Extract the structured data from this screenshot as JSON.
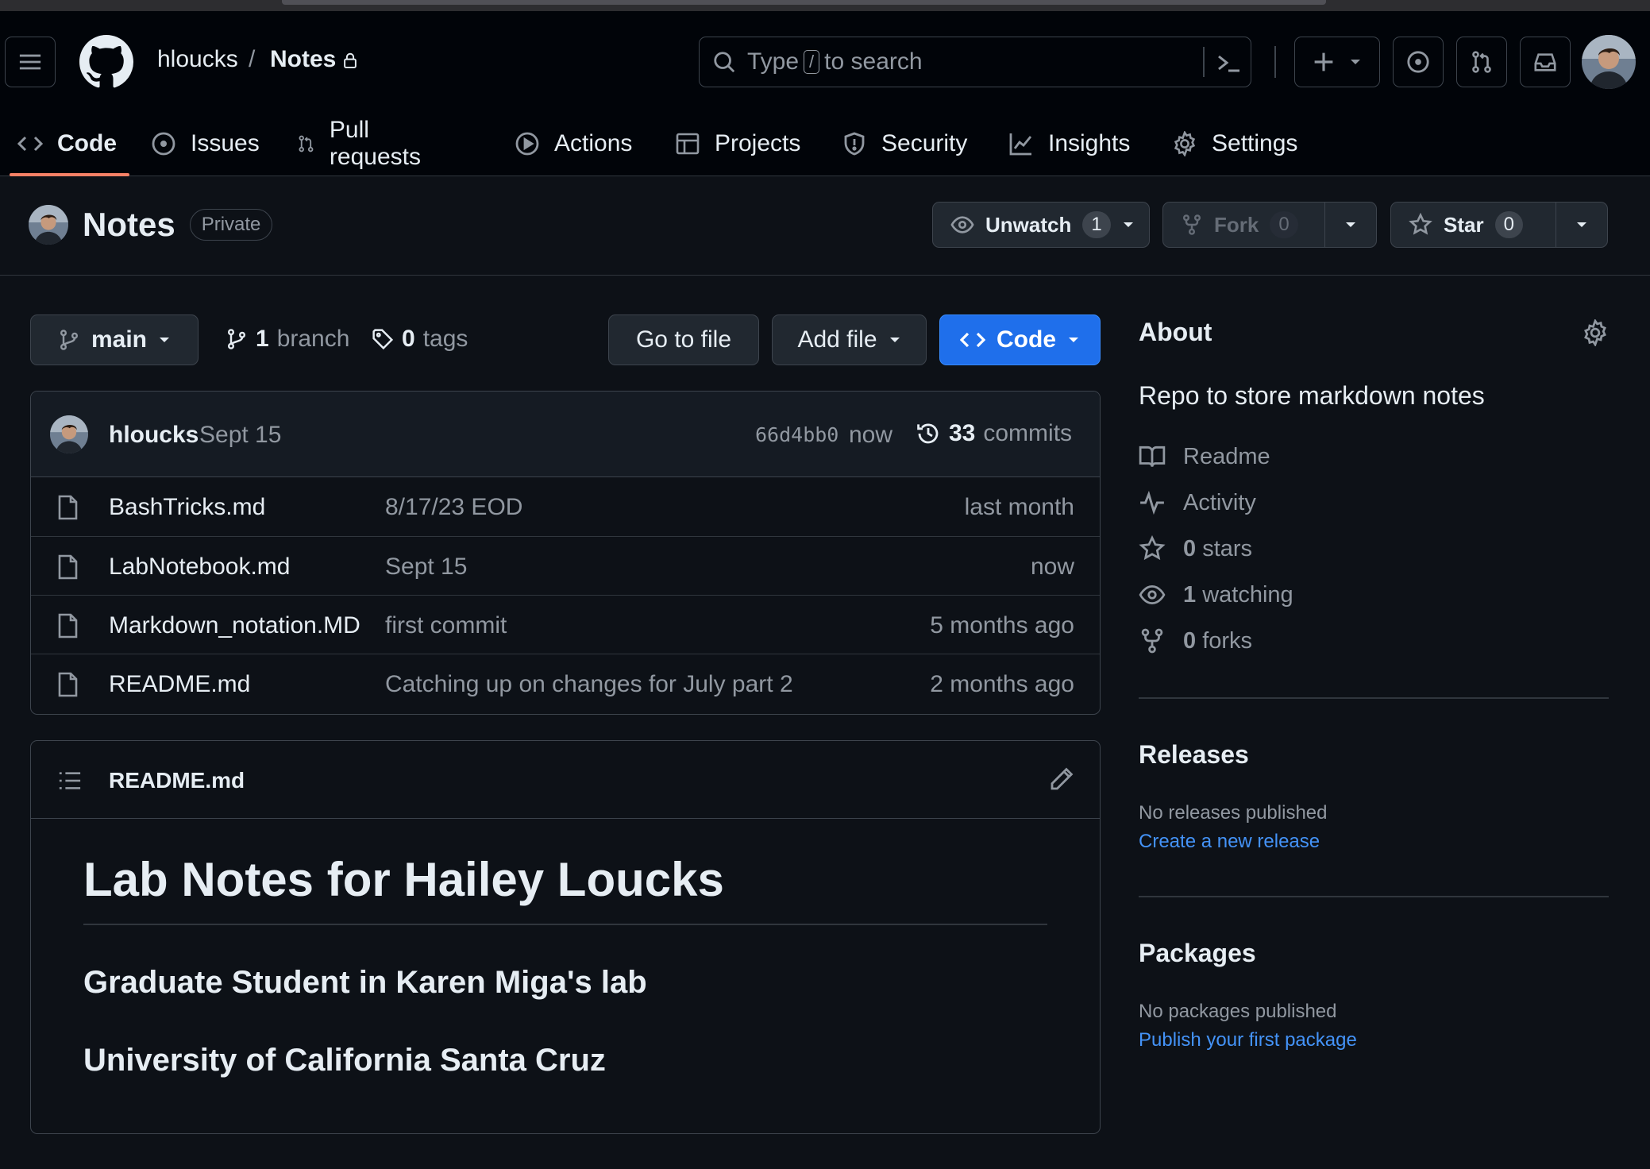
{
  "header": {
    "owner": "hloucks",
    "separator": "/",
    "repo": "Notes",
    "search": {
      "text_before": "Type",
      "key": "/",
      "text_after": "to search"
    },
    "icons": [
      "hamburger-icon",
      "github-logo-icon",
      "lock-icon",
      "search-icon",
      "command-palette-icon",
      "plus-icon",
      "issue-opened-icon",
      "pull-request-icon",
      "inbox-icon"
    ]
  },
  "nav": {
    "tabs": [
      {
        "label": "Code",
        "icon": "code-icon",
        "active": true
      },
      {
        "label": "Issues",
        "icon": "issue-icon"
      },
      {
        "label": "Pull requests",
        "icon": "pull-request-icon"
      },
      {
        "label": "Actions",
        "icon": "play-icon"
      },
      {
        "label": "Projects",
        "icon": "table-icon"
      },
      {
        "label": "Security",
        "icon": "shield-icon"
      },
      {
        "label": "Insights",
        "icon": "graph-icon"
      },
      {
        "label": "Settings",
        "icon": "gear-icon"
      }
    ]
  },
  "repo_header": {
    "name": "Notes",
    "visibility": "Private",
    "unwatch_label": "Unwatch",
    "watch_count": "1",
    "fork_label": "Fork",
    "fork_count": "0",
    "star_label": "Star",
    "star_count": "0"
  },
  "toolbar": {
    "branch": "main",
    "branch_count": "1",
    "branch_word": "branch",
    "tag_count": "0",
    "tag_word": "tags",
    "go_to_file": "Go to file",
    "add_file": "Add file",
    "code": "Code"
  },
  "latest_commit": {
    "author": "hloucks",
    "message": "Sept 15",
    "hash": "66d4bb0",
    "time": "now",
    "commit_count": "33",
    "commit_word": "commits"
  },
  "files": [
    {
      "name": "BashTricks.md",
      "message": "8/17/23 EOD",
      "time": "last month"
    },
    {
      "name": "LabNotebook.md",
      "message": "Sept 15",
      "time": "now"
    },
    {
      "name": "Markdown_notation.MD",
      "message": "first commit",
      "time": "5 months ago"
    },
    {
      "name": "README.md",
      "message": "Catching up on changes for July part 2",
      "time": "2 months ago"
    }
  ],
  "readme": {
    "filename": "README.md",
    "h1": "Lab Notes for Hailey Loucks",
    "h2_1": "Graduate Student in Karen Miga's lab",
    "h2_2": "University of California Santa Cruz"
  },
  "sidebar": {
    "about_title": "About",
    "description": "Repo to store markdown notes",
    "readme": "Readme",
    "activity": "Activity",
    "stars_count": "0",
    "stars_word": "stars",
    "watching_count": "1",
    "watching_word": "watching",
    "forks_count": "0",
    "forks_word": "forks",
    "releases_title": "Releases",
    "releases_empty": "No releases published",
    "releases_link": "Create a new release",
    "packages_title": "Packages",
    "packages_empty": "No packages published",
    "packages_link": "Publish your first package"
  },
  "colors": {
    "background": "#0d1117",
    "header": "#010409",
    "accent_tab": "#f78166",
    "primary_button": "#1f6feb",
    "link": "#4493f8"
  }
}
